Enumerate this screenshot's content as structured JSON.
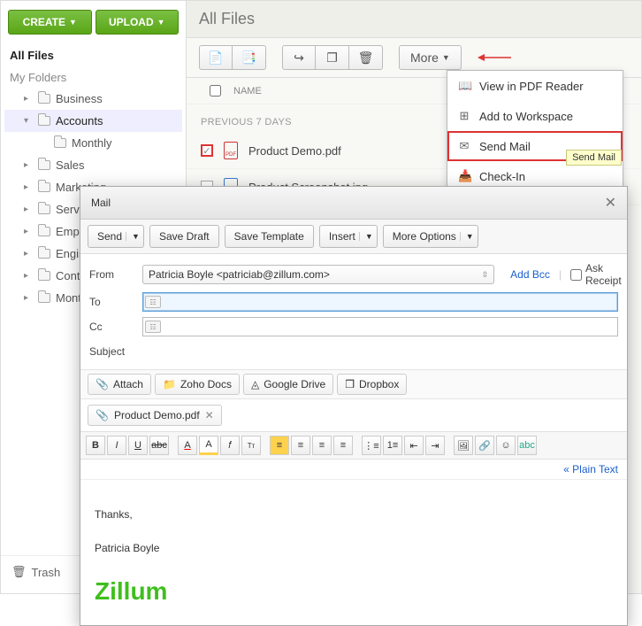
{
  "sidebar": {
    "create": "CREATE",
    "upload": "UPLOAD",
    "all_files": "All Files",
    "my_folders": "My Folders",
    "trash": "Trash",
    "items": [
      {
        "label": "Business"
      },
      {
        "label": "Accounts"
      },
      {
        "label": "Monthly"
      },
      {
        "label": "Sales"
      },
      {
        "label": "Marketing"
      },
      {
        "label": "Services"
      },
      {
        "label": "Employees"
      },
      {
        "label": "Engineering"
      },
      {
        "label": "Content"
      },
      {
        "label": "Monthly"
      }
    ]
  },
  "header": {
    "title": "All Files"
  },
  "toolbar": {
    "more": "More"
  },
  "list": {
    "name_col": "NAME",
    "section": "PREVIOUS 7 DAYS",
    "rows": [
      {
        "name": "Product Demo.pdf"
      },
      {
        "name": "Product Screenshot.jpg"
      }
    ]
  },
  "dropdown": {
    "view_pdf": "View in PDF Reader",
    "add_workspace": "Add to Workspace",
    "send_mail": "Send Mail",
    "check_in": "Check-In"
  },
  "tooltip": "Send Mail",
  "mail": {
    "title": "Mail",
    "send": "Send",
    "save_draft": "Save Draft",
    "save_template": "Save Template",
    "insert": "Insert",
    "more_options": "More Options",
    "from_label": "From",
    "from_value": "Patricia Boyle <patriciab@zillum.com>",
    "add_bcc": "Add Bcc",
    "ask_receipt": "Ask Receipt",
    "to_label": "To",
    "cc_label": "Cc",
    "subject_label": "Subject",
    "attach": "Attach",
    "zoho_docs": "Zoho Docs",
    "google_drive": "Google Drive",
    "dropbox": "Dropbox",
    "attachment": "Product Demo.pdf",
    "plain_text": "« Plain Text",
    "body_thanks": "Thanks,",
    "body_name": "Patricia Boyle",
    "body_brand": "Zillum"
  }
}
